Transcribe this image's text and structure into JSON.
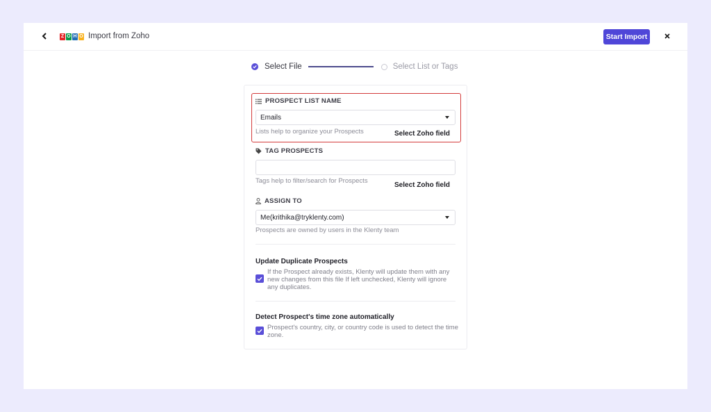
{
  "header": {
    "back_icon": "chevron-left-icon",
    "logo_letters": [
      "Z",
      "O",
      "H",
      "O"
    ],
    "logo_colors": [
      "#e42527",
      "#089949",
      "#226db4",
      "#f9b21d"
    ],
    "title": "Import from Zoho",
    "start_import_label": "Start Import",
    "close_icon": "close-icon"
  },
  "stepper": {
    "steps": [
      {
        "label": "Select File",
        "status": "complete"
      },
      {
        "label": "Select List or Tags",
        "status": "pending"
      }
    ]
  },
  "form": {
    "prospect_list": {
      "label": "PROSPECT LIST NAME",
      "icon": "list-icon",
      "value": "Emails",
      "hint": "Lists help to organize your Prospects",
      "zoho_field_label": "Select Zoho field",
      "highlighted": true
    },
    "tag_prospects": {
      "label": "TAG PROSPECTS",
      "icon": "tag-icon",
      "value": "",
      "placeholder": "",
      "hint": "Tags help to filter/search for Prospects",
      "zoho_field_label": "Select Zoho field"
    },
    "assign_to": {
      "label": "ASSIGN TO",
      "icon": "user-icon",
      "value": "Me(krithika@tryklenty.com)",
      "hint": "Prospects are owned by users in the Klenty team"
    },
    "update_duplicates": {
      "title": "Update Duplicate Prospects",
      "checked": true,
      "description": "If the Prospect already exists, Klenty will update them with any new changes from this file If left unchecked, Klenty will ignore any duplicates."
    },
    "detect_timezone": {
      "title": "Detect Prospect's time zone automatically",
      "checked": true,
      "description": "Prospect's country, city, or country code is used to detect the time zone."
    }
  },
  "colors": {
    "accent": "#5a4fd8",
    "button": "#4f46d8",
    "highlight_border": "#d33a3a",
    "page_background": "#ecebfd"
  }
}
